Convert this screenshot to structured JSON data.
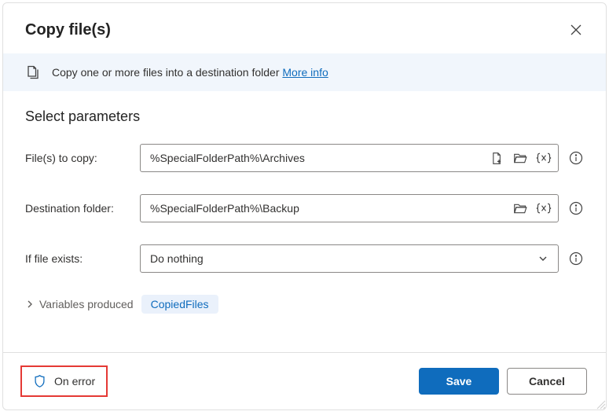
{
  "dialog": {
    "title": "Copy file(s)",
    "info_text": "Copy one or more files into a destination folder",
    "info_link_label": "More info"
  },
  "section": {
    "title": "Select parameters"
  },
  "fields": {
    "files_to_copy": {
      "label": "File(s) to copy:",
      "value": "%SpecialFolderPath%\\Archives"
    },
    "destination_folder": {
      "label": "Destination folder:",
      "value": "%SpecialFolderPath%\\Backup"
    },
    "if_file_exists": {
      "label": "If file exists:",
      "selected": "Do nothing"
    }
  },
  "variables": {
    "toggle_label": "Variables produced",
    "chip_label": "CopiedFiles"
  },
  "footer": {
    "on_error_label": "On error",
    "save_label": "Save",
    "cancel_label": "Cancel"
  }
}
